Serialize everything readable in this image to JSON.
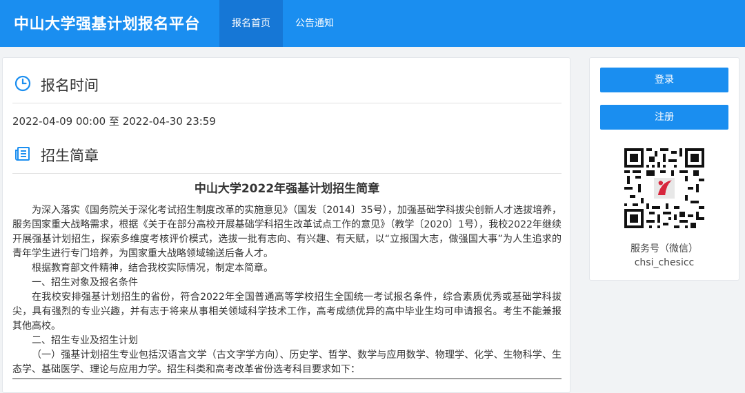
{
  "header": {
    "brand": "中山大学强基计划报名平台",
    "nav": [
      "报名首页",
      "公告通知"
    ]
  },
  "main": {
    "time_section": {
      "title": "报名时间",
      "icon": "clock-icon",
      "value": "2022-04-09 00:00 至 2022-04-30 23:59"
    },
    "brochure_section": {
      "title": "招生简章",
      "icon": "newspaper-icon"
    },
    "document": {
      "title": "中山大学2022年强基计划招生简章",
      "paragraphs": [
        "为深入落实《国务院关于深化考试招生制度改革的实施意见》（国发〔2014〕35号），加强基础学科拔尖创新人才选拔培养，服务国家重大战略需求，根据《关于在部分高校开展基础学科招生改革试点工作的意见》（教学〔2020〕1号），我校2022年继续开展强基计划招生，探索多维度考核评价模式，选拔一批有志向、有兴趣、有天赋，以“立报国大志，做强国大事”为人生追求的青年学生进行专门培养，为国家重大战略领域输送后备人才。",
        "根据教育部文件精神，结合我校实际情况，制定本简章。",
        "一、招生对象及报名条件",
        "在我校安排强基计划招生的省份，符合2022年全国普通高等学校招生全国统一考试报名条件，综合素质优秀或基础学科拔尖，具有强烈的专业兴趣，并有志于将来从事相关领域科学技术工作，高考成绩优异的高中毕业生均可申请报名。考生不能兼报其他高校。",
        "二、招生专业及招生计划",
        "（一）强基计划招生专业包括汉语言文学（古文字学方向）、历史学、哲学、数学与应用数学、物理学、化学、生物科学、生态学、基础医学、理论与应用力学。招生科类和高考改革省份选考科目要求如下："
      ]
    }
  },
  "sidebar": {
    "login": "登录",
    "register": "注册",
    "qr_caption": "服务号（微信）",
    "qr_account": "chsi_chesicc"
  },
  "colors": {
    "primary": "#1a8ef0",
    "nav_active": "#1677d6",
    "background": "#f1f3f5"
  }
}
